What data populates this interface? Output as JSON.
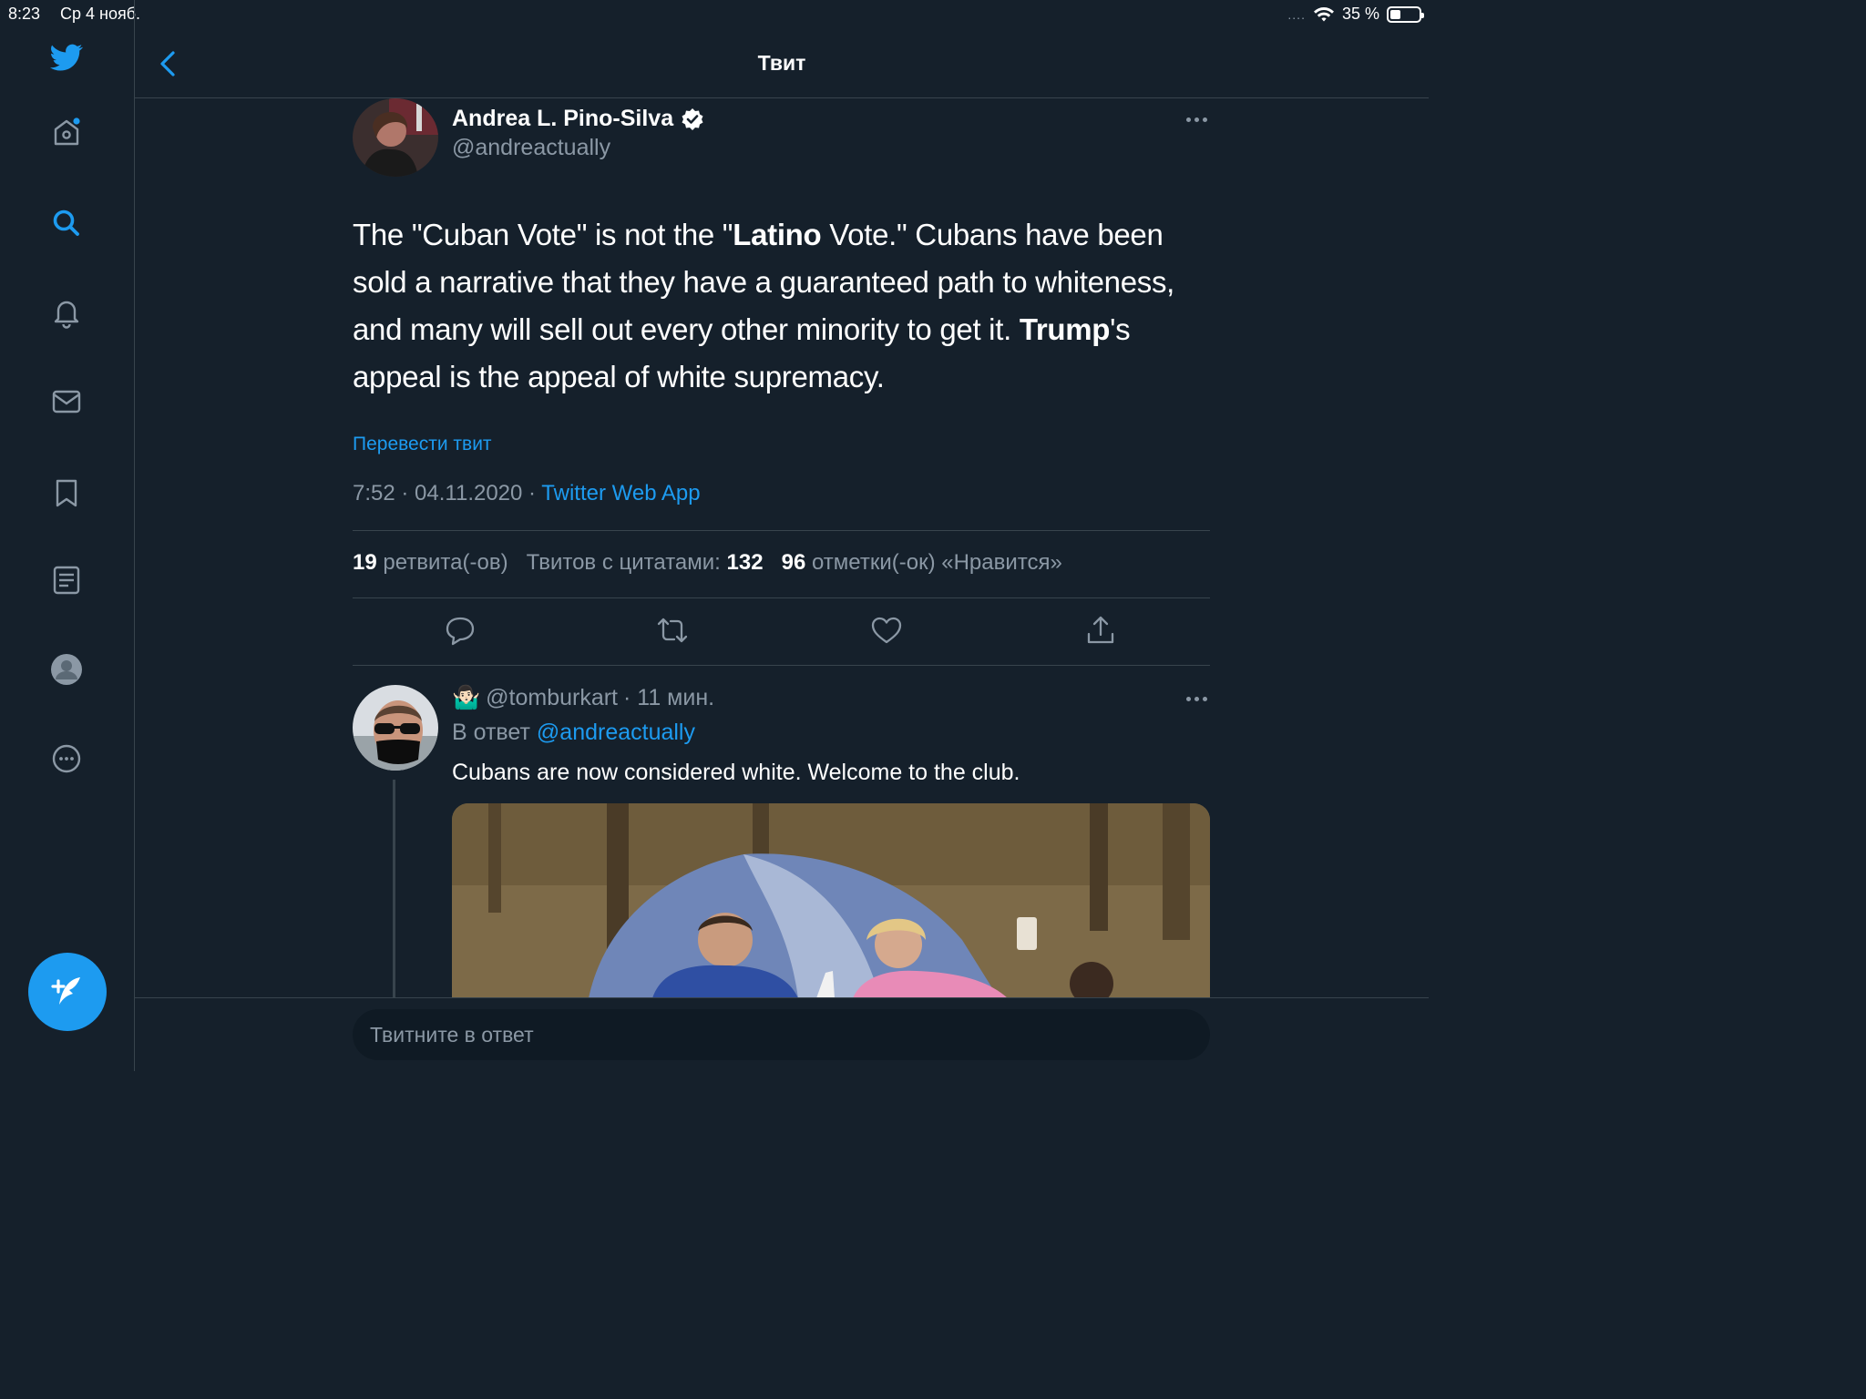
{
  "status_bar": {
    "time": "8:23",
    "date": "Ср 4 нояб.",
    "signal": "....",
    "battery_text": "35 %",
    "battery_level": 0.35
  },
  "header": {
    "title": "Твит"
  },
  "sidebar": {
    "items": [
      {
        "icon": "twitter-logo-icon"
      },
      {
        "icon": "home-icon"
      },
      {
        "icon": "search-icon"
      },
      {
        "icon": "bell-icon"
      },
      {
        "icon": "mail-icon"
      },
      {
        "icon": "bookmark-icon"
      },
      {
        "icon": "lists-icon"
      },
      {
        "icon": "profile-icon"
      },
      {
        "icon": "more-icon"
      }
    ],
    "compose_icon": "compose-tweet-icon"
  },
  "tweet": {
    "author_name": "Andrea L. Pino-Silva",
    "verified": true,
    "handle": "@andreactually",
    "text_parts": [
      {
        "t": "The \"Cuban Vote\" is not the \"",
        "bold": false
      },
      {
        "t": "Latino",
        "bold": true
      },
      {
        "t": " Vote.\" Cubans have been sold a narrative that they have a guaranteed path to whiteness, and many will sell out every other minority to get it. ",
        "bold": false
      },
      {
        "t": "Trump",
        "bold": true
      },
      {
        "t": "'s appeal is the appeal of white supremacy.",
        "bold": false
      }
    ],
    "translate_label": "Перевести твит",
    "timestamp": "7:52 · 04.11.2020 · ",
    "source": "Twitter Web App",
    "stats": {
      "retweets_count": "19",
      "retweets_label": "ретвита(-ов)",
      "quotes_label": "Твитов с цитатами:",
      "quotes_count": "132",
      "likes_count": "96",
      "likes_label": "отметки(-ок) «Нравится»"
    }
  },
  "reply": {
    "emoji": "🤷🏻‍♂️",
    "handle": "@tomburkart",
    "time": "· 11 мин.",
    "reply_to_prefix": "В ответ ",
    "reply_to_handle": "@andreactually",
    "text": "Cubans are now considered white.  Welcome to the club."
  },
  "composer": {
    "placeholder": "Твитните в ответ"
  },
  "colors": {
    "background": "#15202b",
    "accent": "#1d9bf0",
    "secondary_text": "#8b98a5",
    "divider": "#38444d"
  }
}
